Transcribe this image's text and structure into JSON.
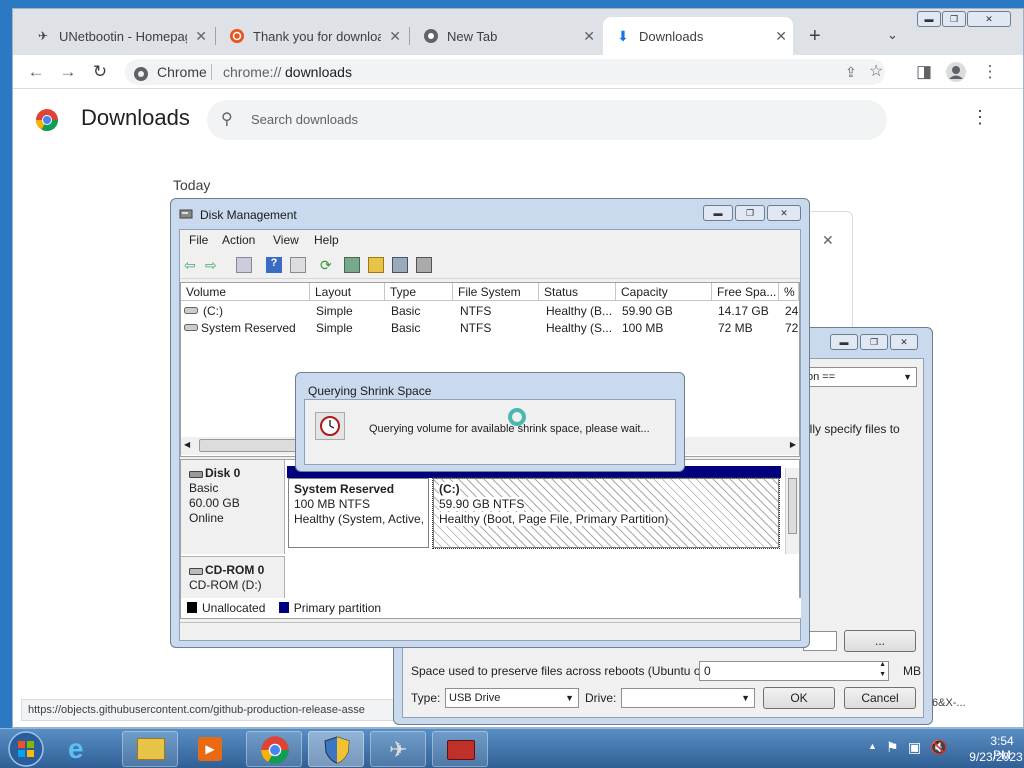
{
  "chrome": {
    "tabs": [
      {
        "title": "UNetbootin - Homepage",
        "favicon": "unetbootin-icon"
      },
      {
        "title": "Thank you for downloading",
        "favicon": "ubuntu-icon"
      },
      {
        "title": "New Tab",
        "favicon": "chrome-icon"
      },
      {
        "title": "Downloads",
        "favicon": "download-icon"
      }
    ],
    "omnibox": {
      "site": "Chrome",
      "url_prefix": "chrome://",
      "url_path": "downloads"
    },
    "page_title": "Downloads",
    "search_placeholder": "Search downloads",
    "section_label": "Today",
    "status_url": "https://objects.githubusercontent.com/github-production-release-asse",
    "status_suffix": "6&X-..."
  },
  "disk_management": {
    "title": "Disk Management",
    "menu": [
      "File",
      "Action",
      "View",
      "Help"
    ],
    "columns": [
      "Volume",
      "Layout",
      "Type",
      "File System",
      "Status",
      "Capacity",
      "Free Spa...",
      "% F"
    ],
    "rows": [
      [
        "(C:)",
        "Simple",
        "Basic",
        "NTFS",
        "Healthy (B...",
        "59.90 GB",
        "14.17 GB",
        "24"
      ],
      [
        "System Reserved",
        "Simple",
        "Basic",
        "NTFS",
        "Healthy (S...",
        "100 MB",
        "72 MB",
        "72"
      ]
    ],
    "disks": [
      {
        "name": "Disk 0",
        "lines": [
          "Basic",
          "60.00 GB",
          "Online"
        ]
      },
      {
        "name": "CD-ROM 0",
        "lines": [
          "CD-ROM (D:)"
        ]
      }
    ],
    "partitions": [
      {
        "name": "System Reserved",
        "size": "100 MB NTFS",
        "status": "Healthy (System, Active,"
      },
      {
        "name": "(C:)",
        "size": "59.90 GB NTFS",
        "status": "Healthy (Boot, Page File, Primary Partition)"
      }
    ],
    "legend": [
      {
        "label": "Unallocated",
        "color": "#000000"
      },
      {
        "label": "Primary partition",
        "color": "#00007f"
      }
    ]
  },
  "shrink_dialog": {
    "title": "Querying Shrink Space",
    "message": "Querying volume for available shrink space, please wait..."
  },
  "unetbootin": {
    "combo_fragment": "on ==",
    "text_fragment": "ally specify files to",
    "browse_label": "...",
    "persist_label": "Space used to preserve files across reboots (Ubuntu only):",
    "persist_value": "0",
    "persist_unit": "MB",
    "type_label": "Type:",
    "type_value": "USB Drive",
    "drive_label": "Drive:",
    "drive_value": "",
    "ok_label": "OK",
    "cancel_label": "Cancel"
  },
  "taskbar": {
    "time": "3:54 PM",
    "date": "9/23/2023"
  }
}
